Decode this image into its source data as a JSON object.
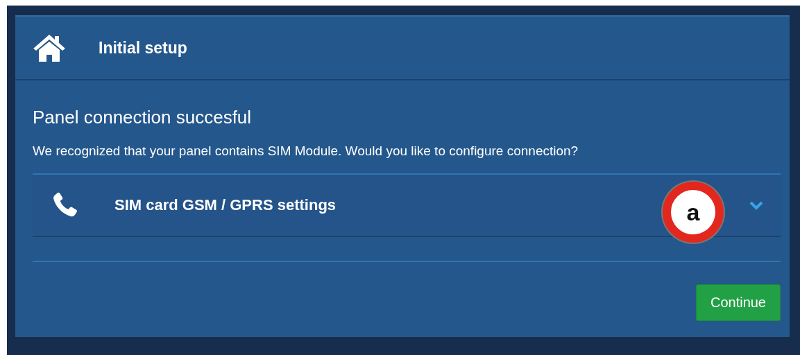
{
  "header": {
    "title": "Initial setup"
  },
  "content": {
    "heading": "Panel connection succesful",
    "message": "We recognized that your panel contains SIM Module. Would you like to configure connection?"
  },
  "sections": [
    {
      "label": "SIM card GSM / GPRS settings",
      "expanded": false
    }
  ],
  "callout": {
    "label": "a"
  },
  "buttons": [
    {
      "label": "Continue",
      "kind": "primary"
    }
  ]
}
